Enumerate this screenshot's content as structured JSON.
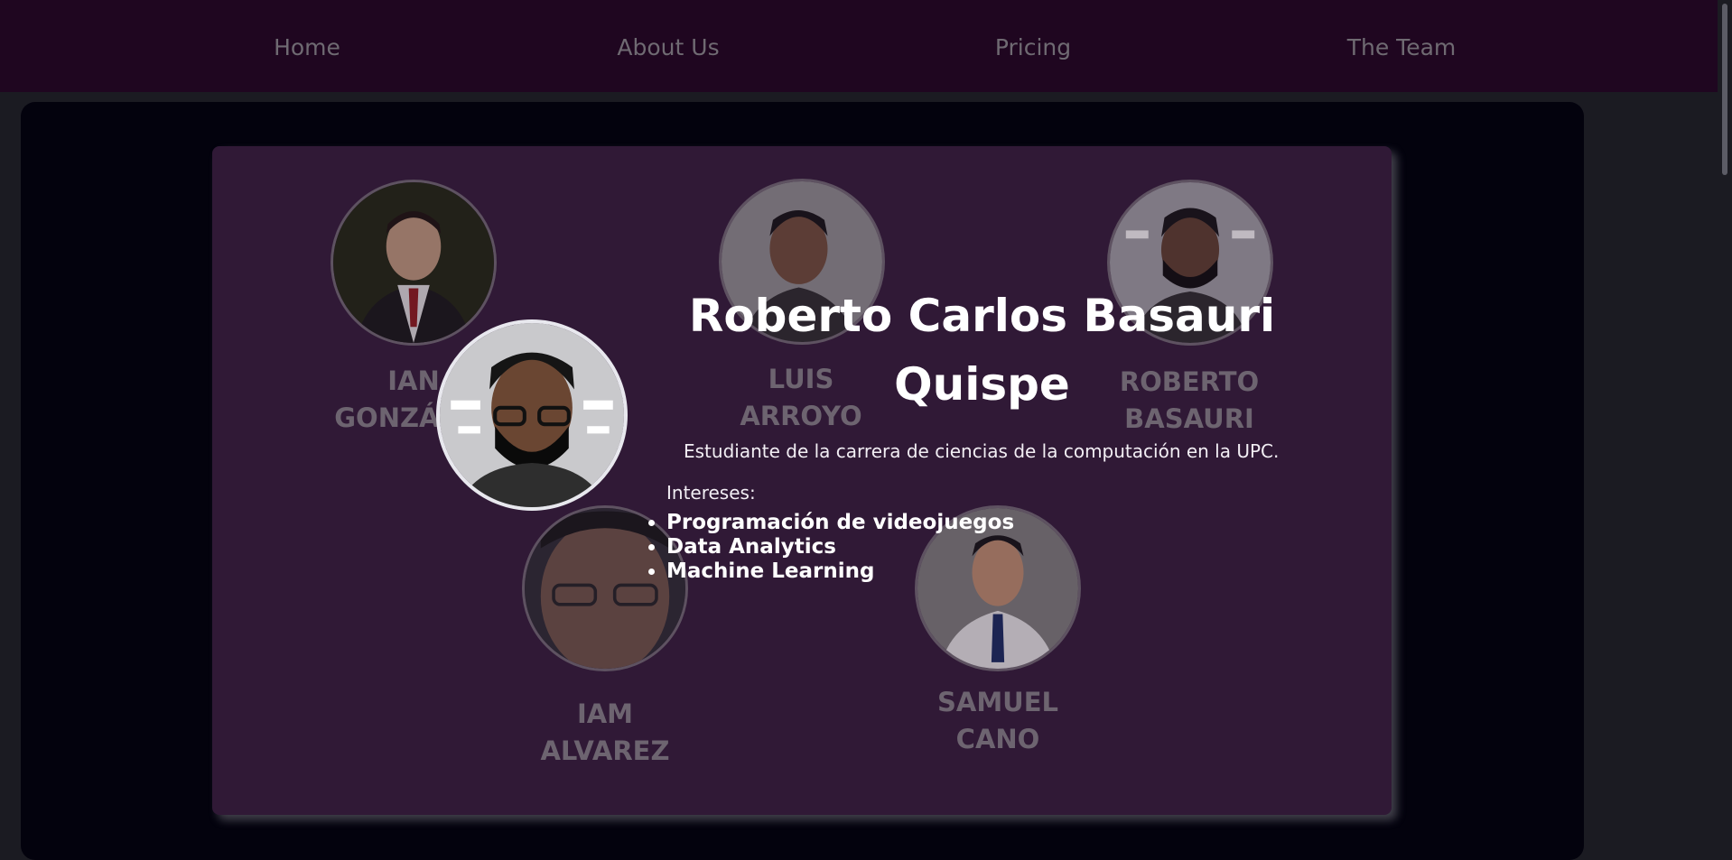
{
  "nav": {
    "items": [
      {
        "label": "Home"
      },
      {
        "label": "About Us"
      },
      {
        "label": "Pricing"
      },
      {
        "label": "The Team"
      }
    ]
  },
  "team": {
    "members": [
      {
        "name_line1": "IAN",
        "name_line2": "GONZÁLEZ"
      },
      {
        "name_line1": "LUIS",
        "name_line2": "ARROYO"
      },
      {
        "name_line1": "ROBERTO",
        "name_line2": "BASAURI"
      },
      {
        "name_line1": "IAM",
        "name_line2": "ALVAREZ"
      },
      {
        "name_line1": "SAMUEL",
        "name_line2": "CANO"
      }
    ],
    "detail": {
      "name": "Roberto Carlos Basauri Quispe",
      "description": "Estudiante de la carrera de ciencias de la computación en la UPC.",
      "interests_label": "Intereses:",
      "interests": [
        "Programación de videojuegos",
        "Data Analytics",
        "Machine Learning"
      ]
    }
  },
  "colors": {
    "navbar": "#1f0620",
    "card": "#301936",
    "panel": "#03020d"
  }
}
